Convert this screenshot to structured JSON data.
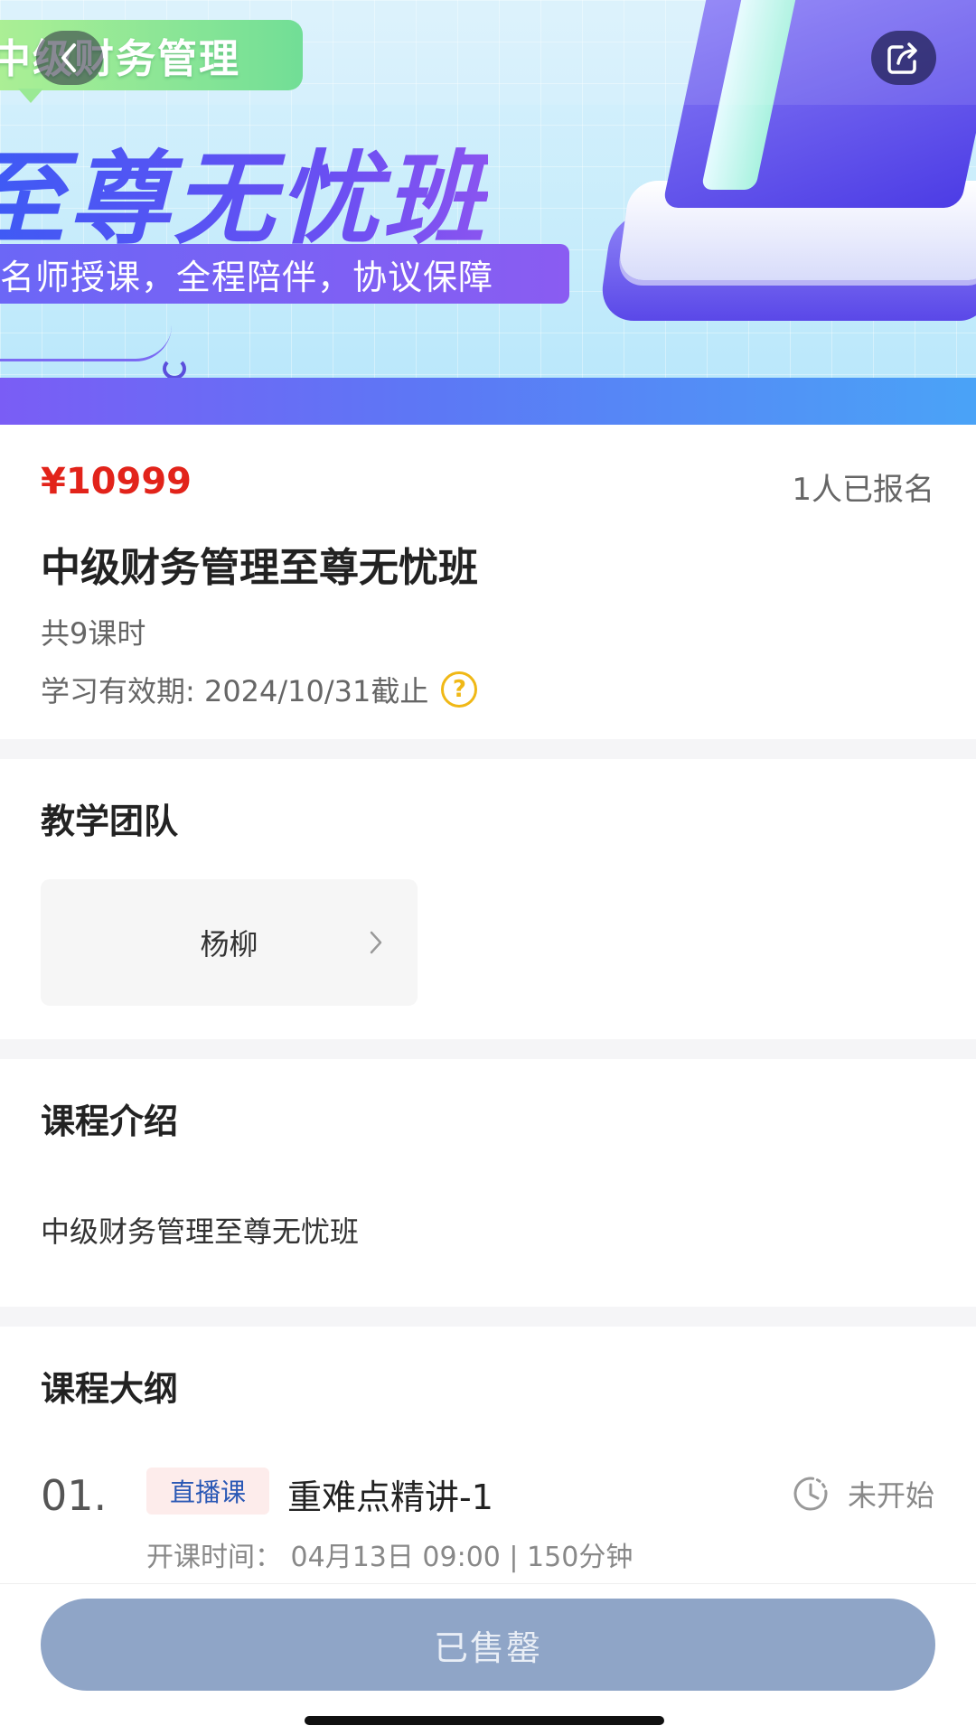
{
  "banner": {
    "tag": "中级财务管理",
    "headline": "至尊无忧班",
    "subline": "名师授课，全程陪伴，协议保障"
  },
  "nav": {
    "back_icon": "chevron-left-icon",
    "share_icon": "share-icon"
  },
  "course": {
    "price": "¥10999",
    "enrolled": "1人已报名",
    "title": "中级财务管理至尊无忧班",
    "lessons": "共9课时",
    "validity": "学习有效期: 2024/10/31截止",
    "validity_help_icon": "question-circle-icon",
    "colors": {
      "price": "#e2231a",
      "help_icon": "#f0b816"
    }
  },
  "team": {
    "heading": "教学团队",
    "teachers": [
      {
        "name": "杨柳"
      }
    ]
  },
  "intro": {
    "heading": "课程介绍",
    "text": "中级财务管理至尊无忧班"
  },
  "outline": {
    "heading": "课程大纲",
    "items": [
      {
        "index": "01.",
        "badge": "直播课",
        "title": "重难点精讲-1",
        "status": "未开始",
        "meta": "开课时间：  04月13日  09:00 | 150分钟"
      }
    ]
  },
  "bottom": {
    "button_label": "已售罄",
    "button_color": "#8fa5c7"
  }
}
